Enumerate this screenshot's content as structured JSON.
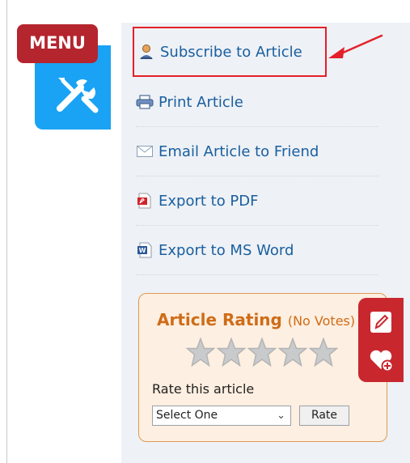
{
  "menu_badge": {
    "label": "MENU"
  },
  "article_tools": {
    "items": [
      {
        "label": "Subscribe to Article",
        "icon": "subscribe-user-icon"
      },
      {
        "label": "Print Article",
        "icon": "printer-icon"
      },
      {
        "label": "Email Article to Friend",
        "icon": "envelope-icon"
      },
      {
        "label": "Export to PDF",
        "icon": "pdf-file-icon"
      },
      {
        "label": "Export to MS Word",
        "icon": "word-doc-icon"
      }
    ]
  },
  "rating": {
    "title": "Article Rating",
    "subtitle": "(No Votes)",
    "stars_filled": 0,
    "stars_total": 5,
    "rate_label": "Rate this article",
    "select_value": "Select One",
    "rate_button": "Rate"
  },
  "colors": {
    "menu_badge": "#b5252e",
    "tools_tile": "#1aa3f5",
    "link": "#1a5fa0",
    "highlight_annotation": "#e3202a",
    "rating_title": "#cf6c17",
    "side_float": "#c8272e"
  }
}
